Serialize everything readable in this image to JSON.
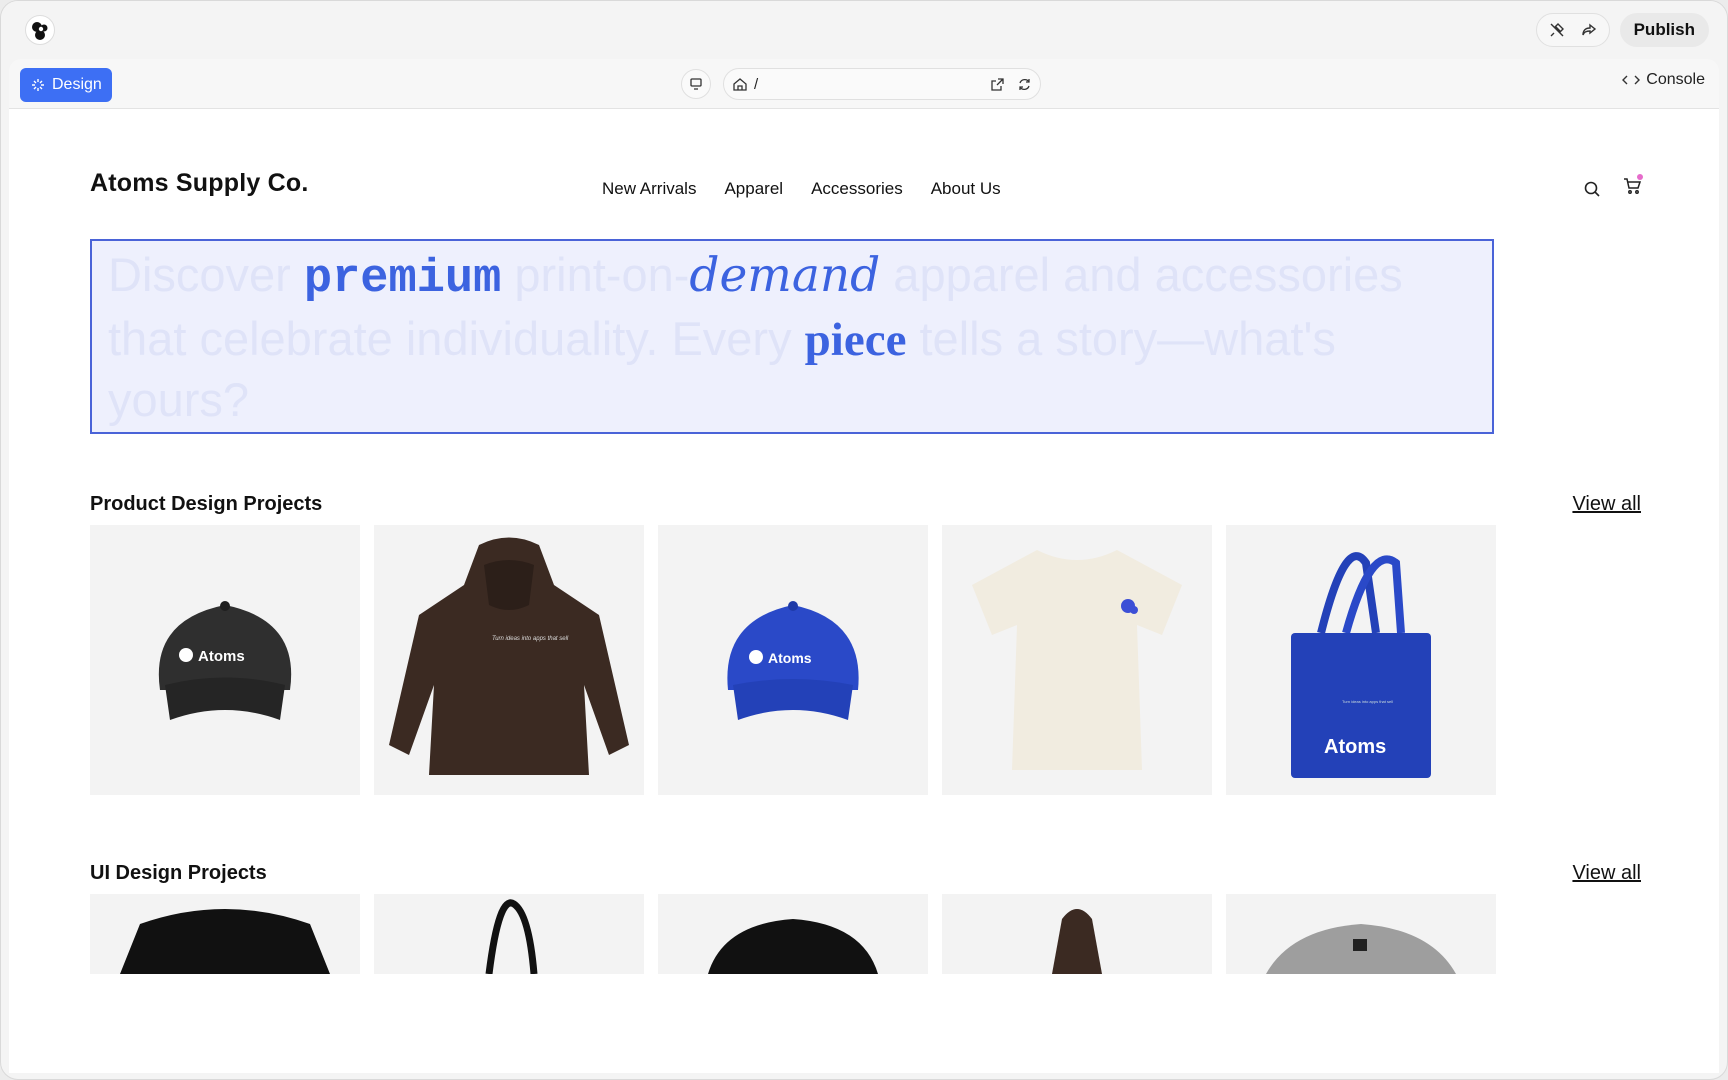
{
  "topbar": {
    "publish_label": "Publish"
  },
  "toolbar": {
    "design_label": "Design",
    "url_path": "/",
    "console_label": "Console"
  },
  "site": {
    "brand": "Atoms Supply Co.",
    "nav": [
      "New Arrivals",
      "Apparel",
      "Accessories",
      "About Us"
    ]
  },
  "hero": {
    "part1": "Discover ",
    "word1": "premium",
    "part2": " print-on-",
    "word2": "demand",
    "part3": " apparel and accessories that celebrate individuality. Every ",
    "word3": "piece",
    "part4": " tells a story—what's yours?"
  },
  "sections": [
    {
      "title": "Product Design Projects",
      "view_all": "View all"
    },
    {
      "title": "UI Design Projects",
      "view_all": "View all"
    }
  ],
  "products": {
    "cap_text": "Atoms",
    "hoodie_text": "Turn ideas into apps that sell",
    "tote_small_text": "Turn ideas into apps that sell",
    "tote_text": "Atoms"
  },
  "colors": {
    "accent": "#3d6ff4",
    "hero_border": "#4a63d8",
    "hero_bg": "#eef0fd",
    "cart_badge": "#e66ccb"
  }
}
